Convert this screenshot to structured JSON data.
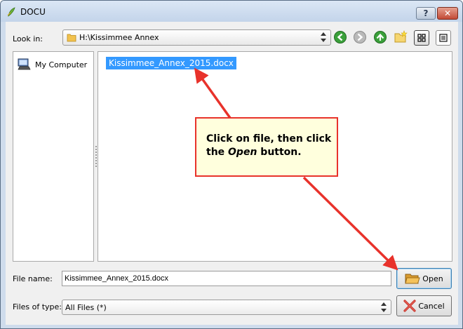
{
  "window": {
    "title": "DOCU",
    "help_label": "?",
    "close_label": "✕"
  },
  "look_in": {
    "label": "Look in:",
    "path": "H:\\Kissimmee Annex"
  },
  "toolbar_icons": [
    "back-icon",
    "forward-icon",
    "up-icon",
    "new-folder-icon",
    "icon-view-icon",
    "detail-view-icon"
  ],
  "sidebar": {
    "items": [
      {
        "label": "My Computer",
        "icon": "computer-icon"
      }
    ]
  },
  "files": [
    {
      "name": "Kissimmee_Annex_2015.docx",
      "icon": "word-doc-icon",
      "selected": true
    }
  ],
  "callout": {
    "line1": "Click on file, then click",
    "line2_prefix": "the ",
    "line2_em": "Open",
    "line2_suffix": " button."
  },
  "file_name": {
    "label": "File name:",
    "value": "Kissimmee_Annex_2015.docx"
  },
  "file_type": {
    "label": "Files of type:",
    "value": "All Files (*)"
  },
  "buttons": {
    "open": "Open",
    "cancel": "Cancel"
  },
  "colors": {
    "selection": "#3399ff",
    "callout_border": "#e8322b",
    "callout_fill": "#ffffdd",
    "arrow": "#e8322b"
  }
}
